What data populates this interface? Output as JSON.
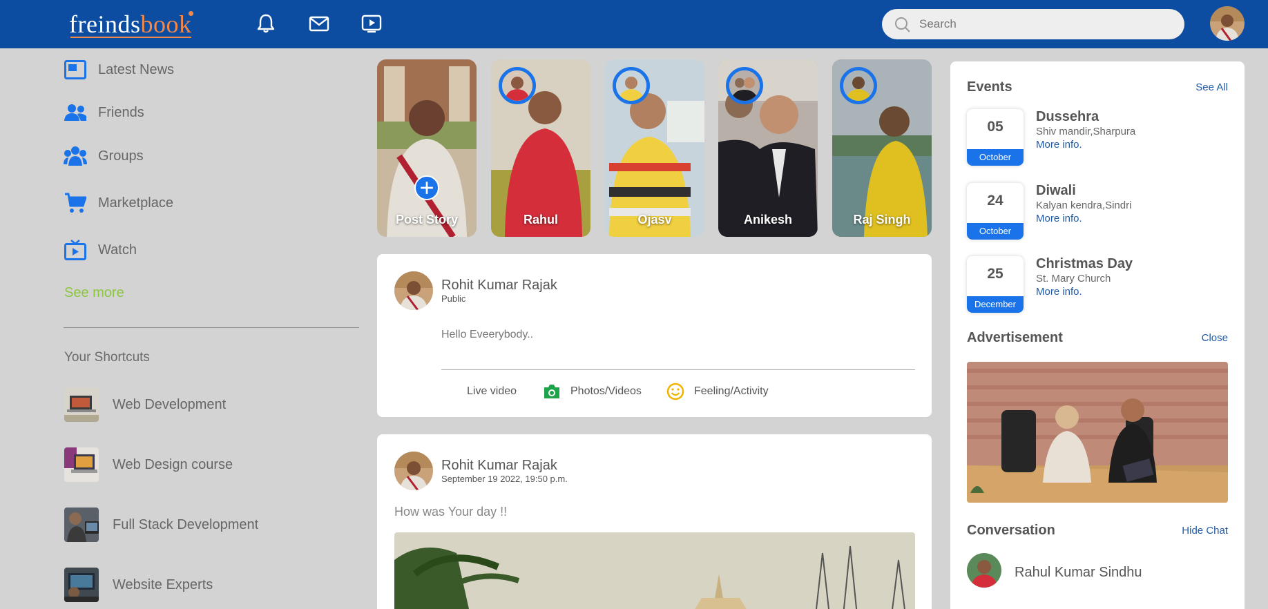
{
  "brand": {
    "part1": "freinds",
    "part2": "book"
  },
  "header": {
    "nav_icons": [
      "bell-icon",
      "mail-icon",
      "video-play-icon"
    ],
    "search_placeholder": "Search"
  },
  "sidebar": {
    "items": [
      {
        "label": "Latest News",
        "icon": "news-icon"
      },
      {
        "label": "Friends",
        "icon": "friends-icon"
      },
      {
        "label": "Groups",
        "icon": "groups-icon"
      },
      {
        "label": "Marketplace",
        "icon": "cart-icon"
      },
      {
        "label": "Watch",
        "icon": "tv-icon"
      }
    ],
    "see_more": "See more",
    "shortcuts_title": "Your Shortcuts",
    "shortcuts": [
      {
        "label": "Web Development"
      },
      {
        "label": "Web Design course"
      },
      {
        "label": "Full Stack Development"
      },
      {
        "label": "Website Experts"
      }
    ]
  },
  "stories": [
    {
      "name": "Post Story"
    },
    {
      "name": "Rahul"
    },
    {
      "name": "Ojasv"
    },
    {
      "name": "Anikesh"
    },
    {
      "name": "Raj Singh"
    }
  ],
  "composer": {
    "author": "Rohit Kumar Rajak",
    "visibility": "Public",
    "placeholder": "Hello Eveerybody..",
    "actions": [
      {
        "label": "Live video"
      },
      {
        "label": "Photos/Videos",
        "icon": "camera-icon"
      },
      {
        "label": "Feeling/Activity",
        "icon": "smile-icon"
      }
    ]
  },
  "post": {
    "author": "Rohit Kumar Rajak",
    "timestamp": "September 19 2022, 19:50 p.m.",
    "text": "How was Your day !!"
  },
  "events": {
    "title": "Events",
    "see_all": "See All",
    "items": [
      {
        "day": "05",
        "month": "October",
        "name": "Dussehra",
        "place": "Shiv mandir,Sharpura",
        "more": "More info."
      },
      {
        "day": "24",
        "month": "October",
        "name": "Diwali",
        "place": "Kalyan kendra,Sindri",
        "more": "More info."
      },
      {
        "day": "25",
        "month": "December",
        "name": "Christmas Day",
        "place": "St. Mary Church",
        "more": "More info."
      }
    ]
  },
  "advertisement": {
    "title": "Advertisement",
    "close": "Close"
  },
  "conversation": {
    "title": "Conversation",
    "hide": "Hide Chat",
    "contact": "Rahul Kumar Sindhu"
  },
  "colors": {
    "header": "#0c4da2",
    "accent": "#1a73e8",
    "brand_accent": "#f2894a",
    "see_more": "#8cc63f",
    "background": "#d3d3d3"
  }
}
